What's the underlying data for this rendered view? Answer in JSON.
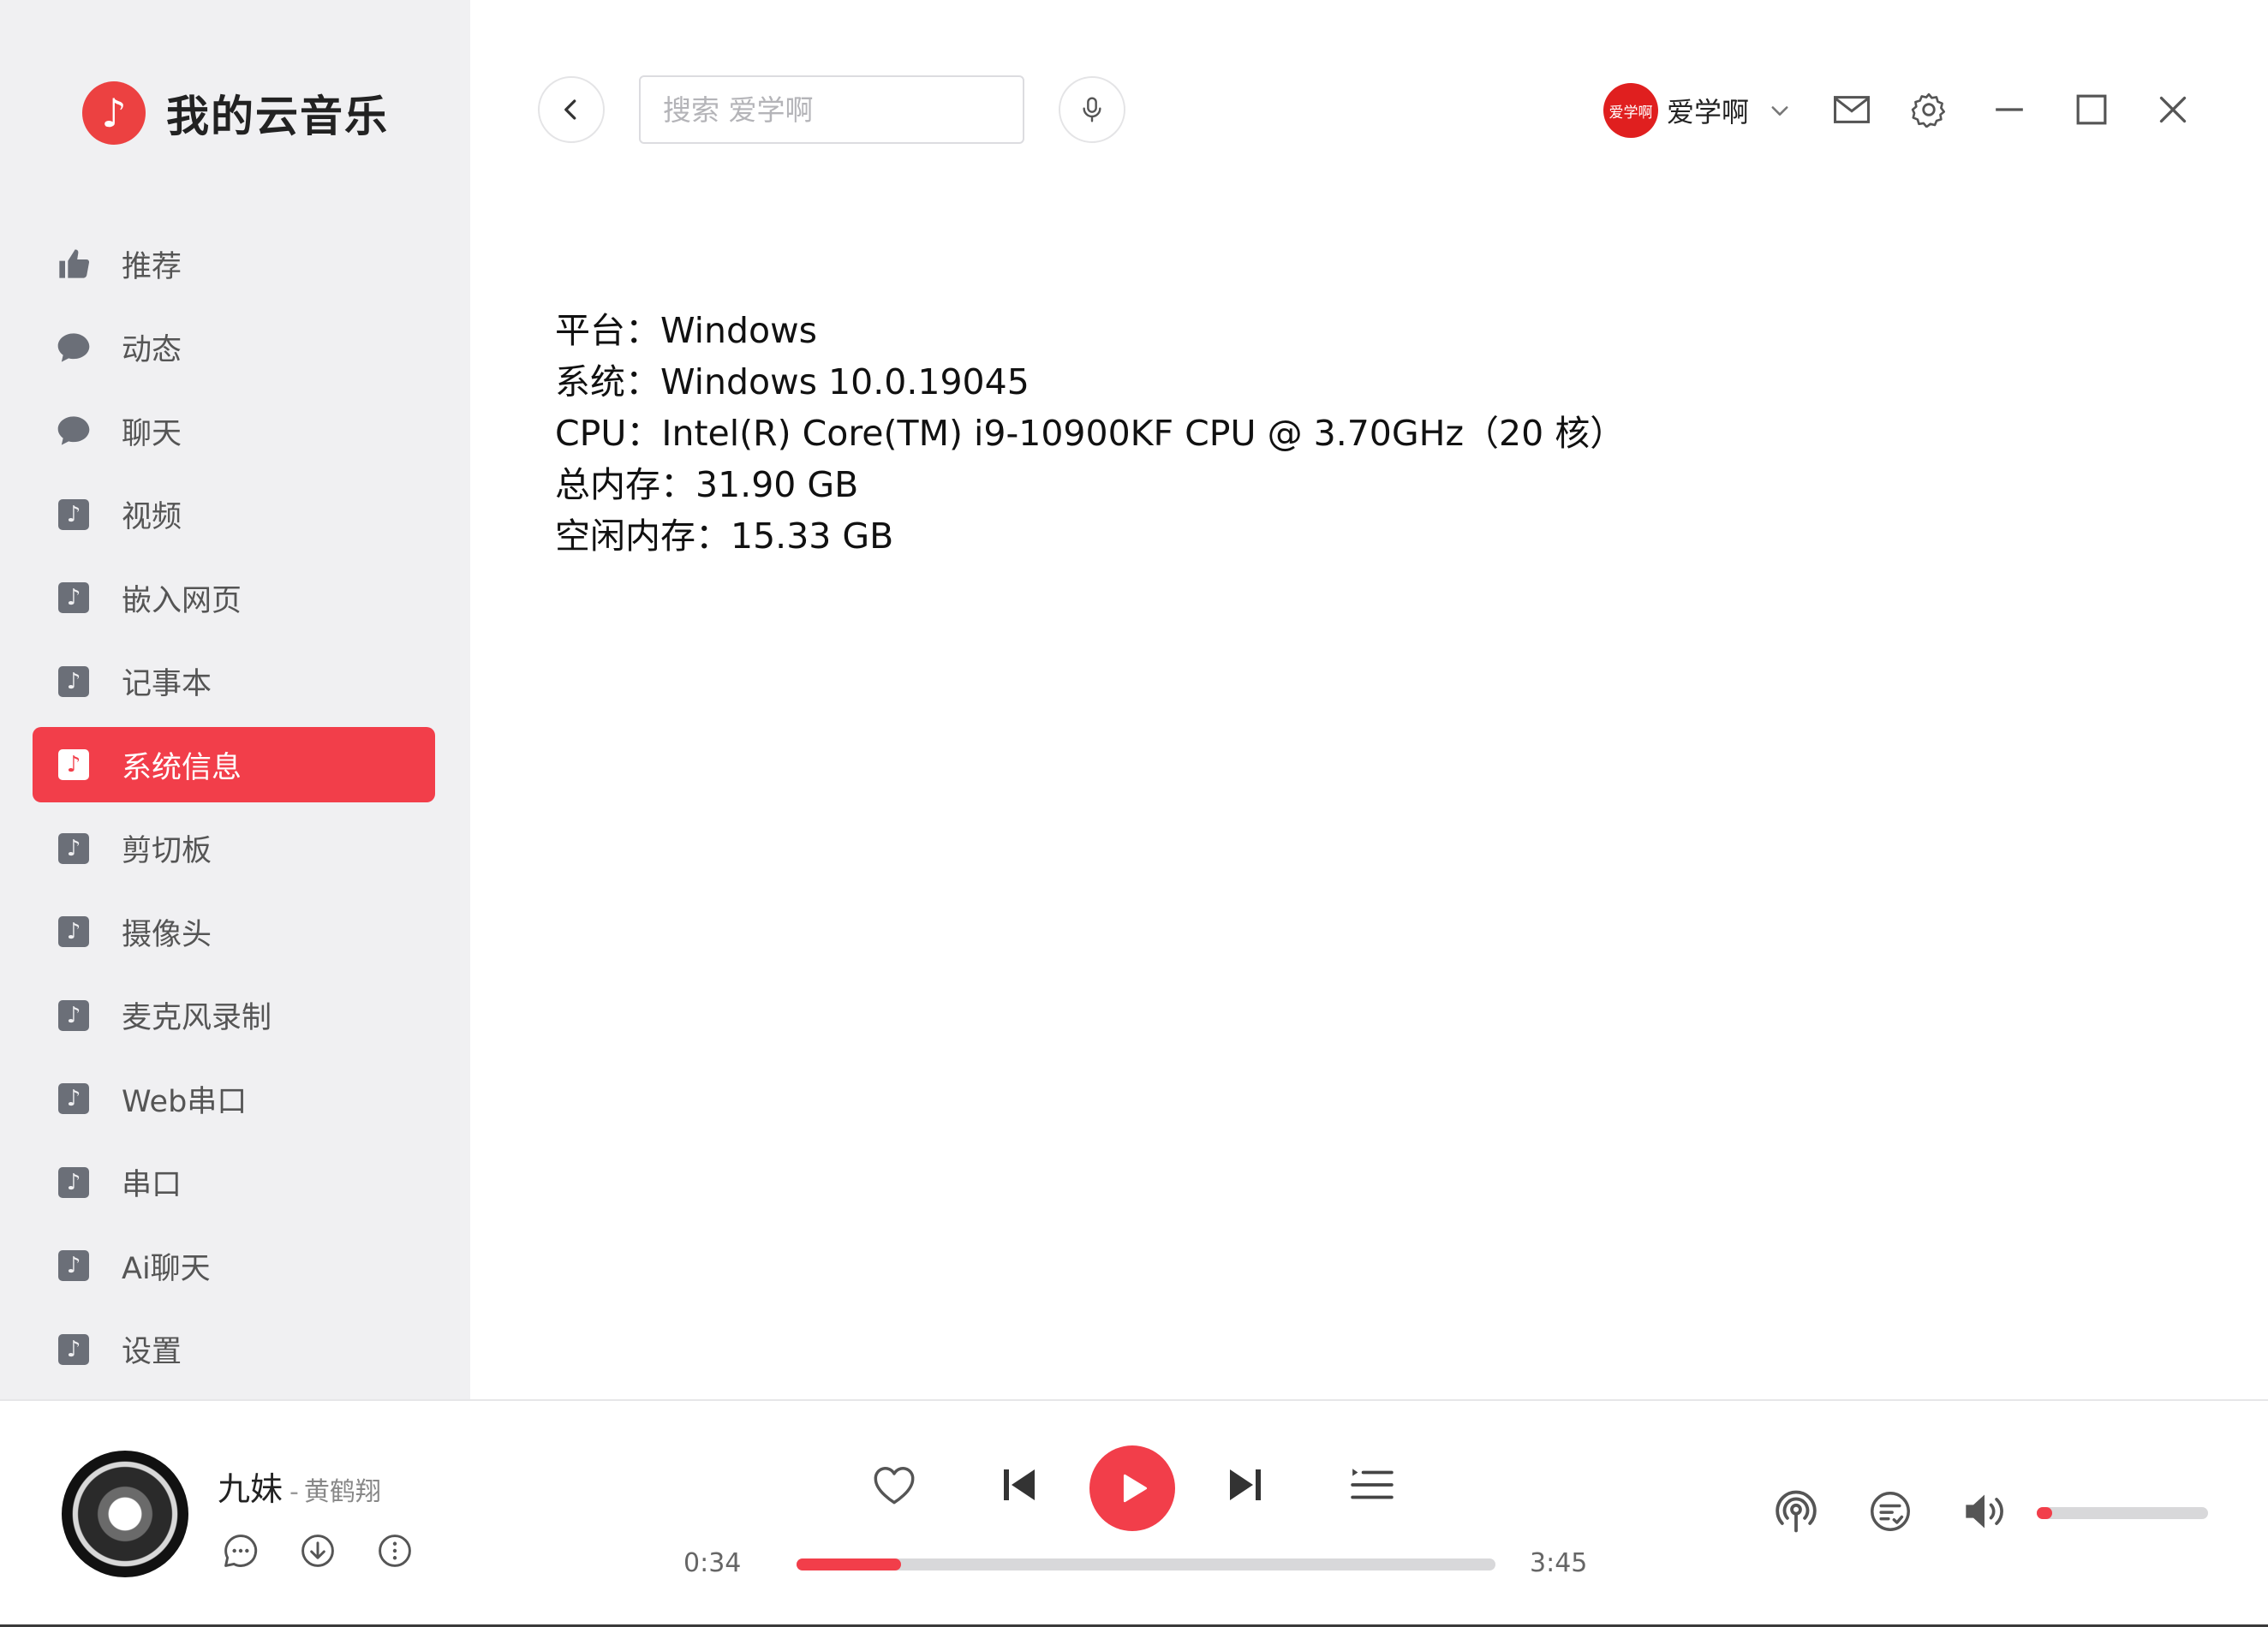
{
  "app": {
    "title": "我的云音乐",
    "logo_icon": "music-note-icon",
    "accent": "#ec4141"
  },
  "sidebar": {
    "items": [
      {
        "label": "推荐",
        "icon": "thumbs-up-icon",
        "active": false
      },
      {
        "label": "动态",
        "icon": "chat-bubble-icon",
        "active": false
      },
      {
        "label": "聊天",
        "icon": "chat-bubble-icon",
        "active": false
      },
      {
        "label": "视频",
        "icon": "music-note-icon",
        "active": false
      },
      {
        "label": "嵌入网页",
        "icon": "music-note-icon",
        "active": false
      },
      {
        "label": "记事本",
        "icon": "music-note-icon",
        "active": false
      },
      {
        "label": "系统信息",
        "icon": "music-note-icon",
        "active": true
      },
      {
        "label": "剪切板",
        "icon": "music-note-icon",
        "active": false
      },
      {
        "label": "摄像头",
        "icon": "music-note-icon",
        "active": false
      },
      {
        "label": "麦克风录制",
        "icon": "music-note-icon",
        "active": false
      },
      {
        "label": "Web串口",
        "icon": "music-note-icon",
        "active": false
      },
      {
        "label": "串口",
        "icon": "music-note-icon",
        "active": false
      },
      {
        "label": "Ai聊天",
        "icon": "music-note-icon",
        "active": false
      },
      {
        "label": "设置",
        "icon": "music-note-icon",
        "active": false
      }
    ]
  },
  "header": {
    "search": {
      "placeholder": "搜索 爱学啊",
      "value": ""
    },
    "user": {
      "avatar_text": "爱学啊",
      "name": "爱学啊"
    }
  },
  "sysinfo": {
    "platform": "平台：Windows",
    "system": "系统：Windows 10.0.19045",
    "cpu": "CPU：Intel(R) Core(TM) i9-10900KF CPU @ 3.70GHz（20 核）",
    "total_mem": "总内存：31.90 GB",
    "free_mem": "空闲内存：15.33 GB"
  },
  "player": {
    "song": "九妹",
    "separator": "-",
    "artist": "黄鹤翔",
    "current_time": "0:34",
    "total_time": "3:45",
    "progress": 0.15,
    "volume": 0.05
  }
}
